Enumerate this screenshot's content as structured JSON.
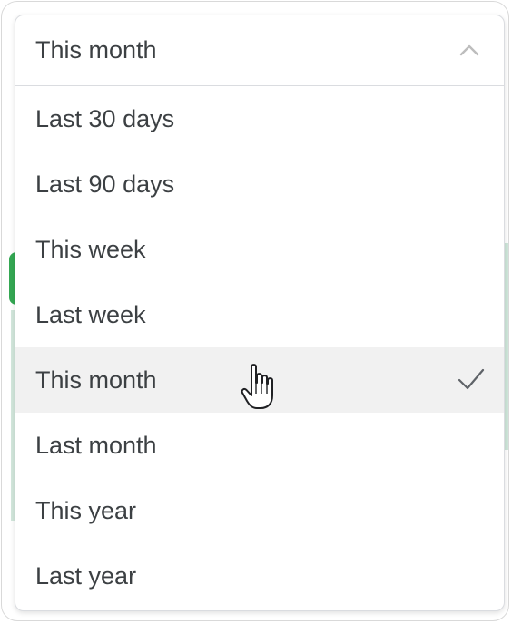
{
  "select": {
    "current_value": "This month",
    "expanded": true,
    "toggle_icon": "chevron-up-icon"
  },
  "options": [
    {
      "label": "Last 30 days",
      "selected": false
    },
    {
      "label": "Last 90 days",
      "selected": false
    },
    {
      "label": "This week",
      "selected": false
    },
    {
      "label": "Last week",
      "selected": false
    },
    {
      "label": "This month",
      "selected": true
    },
    {
      "label": "Last month",
      "selected": false
    },
    {
      "label": "This year",
      "selected": false
    },
    {
      "label": "Last year",
      "selected": false
    }
  ],
  "selected_indicator_icon": "checkmark-icon",
  "pointer_icon": "hand-pointer-icon",
  "colors": {
    "text": "#3c4043",
    "border": "#dadce0",
    "selected_background": "#f1f1f1",
    "accent_green": "#34a853"
  }
}
